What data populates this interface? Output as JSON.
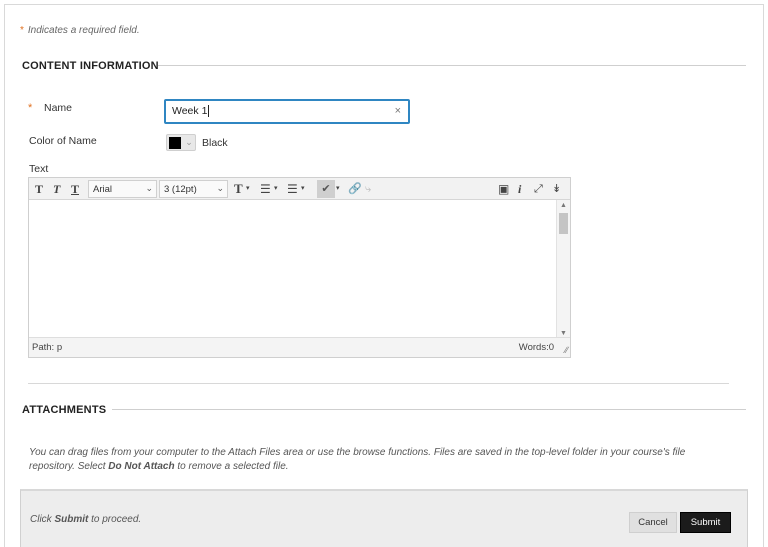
{
  "required_note": {
    "star": "*",
    "text": "Indicates a required field."
  },
  "content_section": {
    "title": "CONTENT INFORMATION"
  },
  "name_field": {
    "star": "*",
    "label": "Name",
    "value": "Week 1",
    "clear_glyph": "×"
  },
  "color_field": {
    "label": "Color of Name",
    "swatch_color": "#000000",
    "value": "Black"
  },
  "text_field": {
    "label": "Text"
  },
  "editor": {
    "toolbar": {
      "bold_glyph": "T",
      "italic_glyph": "T",
      "underline_glyph": "T",
      "font_family": "Arial",
      "font_size": "3 (12pt)",
      "icons": [
        "text-format-icon",
        "bullet-list-icon",
        "numbered-list-icon",
        "spellcheck-icon",
        "link-icon",
        "unlink-icon",
        "preview-icon",
        "info-icon",
        "fullscreen-icon",
        "more-tools-icon"
      ]
    },
    "path_label": "Path: p",
    "words_label": "Words:0"
  },
  "attachments_section": {
    "title": "ATTACHMENTS"
  },
  "attach_help": {
    "part1": "You can drag files from your computer to the Attach Files area or use the browse functions. Files are saved in the top-level folder in your course's file repository.  Select ",
    "bold": "Do Not Attach",
    "part2": " to remove a selected file."
  },
  "footer": {
    "proceed_pre": "Click ",
    "proceed_bold": "Submit",
    "proceed_post": " to proceed.",
    "cancel_label": "Cancel",
    "submit_label": "Submit"
  },
  "colors": {
    "accent_focus": "#2f86c2",
    "required_star": "#e07020",
    "submit_bg": "#1b1b1b"
  }
}
